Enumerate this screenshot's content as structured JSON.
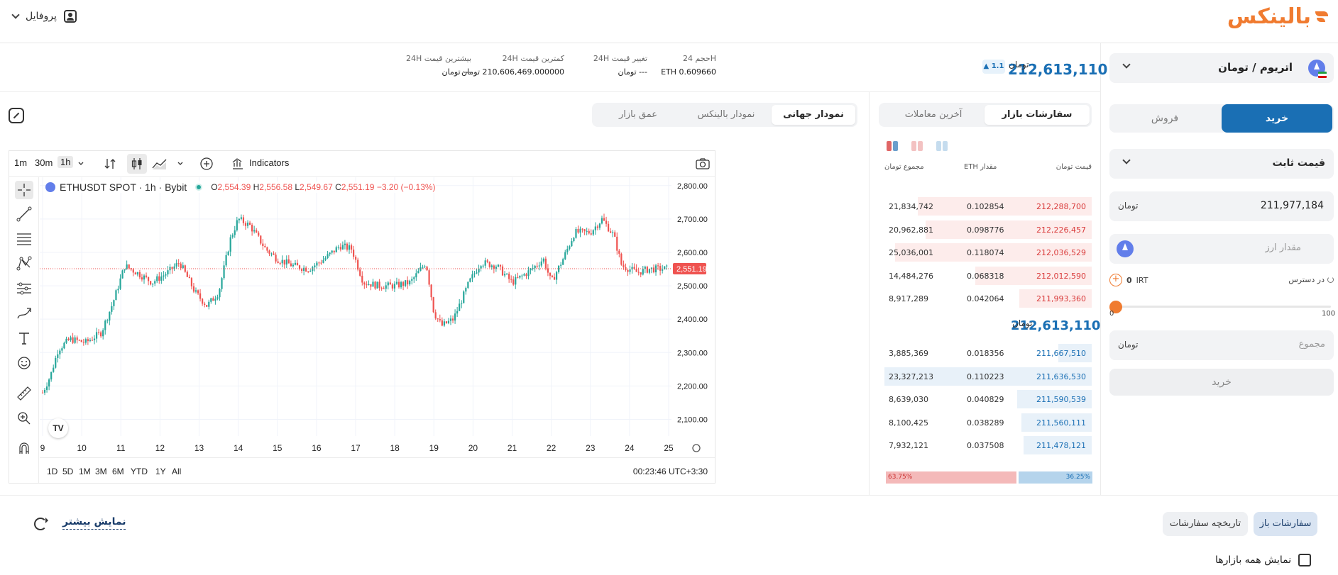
{
  "header": {
    "logo_text": "بالینکس",
    "profile_label": "پروفایل"
  },
  "order_form": {
    "pair_label": "اتریوم / تومان",
    "buy_tab": "خرید",
    "sell_tab": "فروش",
    "order_type": "قیمت ثابت",
    "price_value": "211,977,184",
    "price_unit": "تومان",
    "amount_placeholder": "مقدار ارز",
    "available_label": "در دسترس",
    "available_value": "0",
    "available_currency": "IRT",
    "slider_min": "0",
    "slider_max": "100",
    "slider_value": 0,
    "total_placeholder": "مجموع",
    "total_unit": "تومان",
    "submit_label": "خرید"
  },
  "ticker": {
    "last_price": "212,613,110",
    "last_price_unit": "تومان",
    "change": "1.1",
    "stats": [
      {
        "label": "حجم 24H",
        "value": "ETH 0.609660"
      },
      {
        "label": "تغییر قیمت 24H",
        "value": "--- تومان"
      },
      {
        "label": "کمترین قیمت 24H",
        "value": "210,606,469.000000 تومان"
      },
      {
        "label": "بیشترین قیمت 24H",
        "value": "--- تومان"
      }
    ]
  },
  "orderbook": {
    "tabs": [
      "سفارشات بازار",
      "آخرین معاملات"
    ],
    "headers": {
      "price": "قیمت تومان",
      "amount": "مقدار ETH",
      "total": "مجموع تومان"
    },
    "asks": [
      {
        "price": "212,288,700",
        "amount": "0.102854",
        "total": "21,834,742",
        "depth": 0.84
      },
      {
        "price": "212,226,457",
        "amount": "0.098776",
        "total": "20,962,881",
        "depth": 0.8
      },
      {
        "price": "212,036,529",
        "amount": "0.118074",
        "total": "25,036,001",
        "depth": 0.95
      },
      {
        "price": "212,012,590",
        "amount": "0.068318",
        "total": "14,484,276",
        "depth": 0.56
      },
      {
        "price": "211,993,360",
        "amount": "0.042064",
        "total": "8,917,289",
        "depth": 0.35
      }
    ],
    "mid_price": "212,613,110",
    "mid_unit": "تومان",
    "bids": [
      {
        "price": "211,667,510",
        "amount": "0.018356",
        "total": "3,885,369",
        "depth": 0.16
      },
      {
        "price": "211,636,530",
        "amount": "0.110223",
        "total": "23,327,213",
        "depth": 1.0
      },
      {
        "price": "211,590,539",
        "amount": "0.040829",
        "total": "8,639,030",
        "depth": 0.36
      },
      {
        "price": "211,560,111",
        "amount": "0.038289",
        "total": "8,100,425",
        "depth": 0.34
      },
      {
        "price": "211,478,121",
        "amount": "0.037508",
        "total": "7,932,121",
        "depth": 0.33
      }
    ],
    "sell_ratio": "63.75%",
    "buy_ratio": "36.25%",
    "sell_ratio_value": 0.6375
  },
  "chart_panel": {
    "tabs": [
      "نمودار جهانی",
      "نمودار بالینکس",
      "عمق بازار"
    ],
    "timeframes": [
      "1m",
      "30m",
      "1h"
    ],
    "indicators_label": "Indicators",
    "ranges": [
      "1D",
      "5D",
      "1M",
      "3M",
      "6M",
      "YTD",
      "1Y",
      "All"
    ],
    "clock": "00:23:46 UTC+3:30",
    "symbol": "ETHUSDT SPOT · 1h · Bybit",
    "ohlc": {
      "o_label": "O",
      "o": "2,554.39",
      "h_label": "H",
      "h": "2,556.58",
      "l_label": "L",
      "l": "2,549.67",
      "c_label": "C",
      "c": "2,551.19",
      "chg": "−3.20 (−0.13%)"
    },
    "last_label": "2,551.19",
    "colors": {
      "up": "#26a69a",
      "down": "#ef5350"
    }
  },
  "chart_data": {
    "type": "candlestick",
    "title": "",
    "x_ticks": [
      "9",
      "10",
      "11",
      "12",
      "13",
      "14",
      "15",
      "16",
      "17",
      "18",
      "19",
      "20",
      "21",
      "22",
      "23",
      "24",
      "25"
    ],
    "y_ticks": [
      "2,800.00",
      "2,700.00",
      "2,600.00",
      "2,500.00",
      "2,400.00",
      "2,300.00",
      "2,200.00",
      "2,100.00"
    ],
    "ylim": [
      2050,
      2825
    ],
    "last_price": 2551.19,
    "anchors": [
      [
        9.0,
        2180
      ],
      [
        9.2,
        2230
      ],
      [
        9.4,
        2310
      ],
      [
        9.7,
        2340
      ],
      [
        10.1,
        2330
      ],
      [
        10.5,
        2360
      ],
      [
        10.8,
        2450
      ],
      [
        11.1,
        2560
      ],
      [
        11.4,
        2540
      ],
      [
        11.8,
        2510
      ],
      [
        12.2,
        2540
      ],
      [
        12.5,
        2570
      ],
      [
        12.9,
        2480
      ],
      [
        13.2,
        2440
      ],
      [
        13.5,
        2480
      ],
      [
        13.8,
        2640
      ],
      [
        14.0,
        2700
      ],
      [
        14.3,
        2680
      ],
      [
        14.7,
        2610
      ],
      [
        15.0,
        2580
      ],
      [
        15.4,
        2560
      ],
      [
        15.8,
        2550
      ],
      [
        16.2,
        2580
      ],
      [
        16.6,
        2620
      ],
      [
        16.9,
        2610
      ],
      [
        17.2,
        2510
      ],
      [
        17.6,
        2500
      ],
      [
        18.0,
        2500
      ],
      [
        18.4,
        2510
      ],
      [
        18.8,
        2570
      ],
      [
        19.0,
        2420
      ],
      [
        19.2,
        2380
      ],
      [
        19.5,
        2400
      ],
      [
        19.9,
        2510
      ],
      [
        20.2,
        2570
      ],
      [
        20.6,
        2560
      ],
      [
        21.0,
        2510
      ],
      [
        21.4,
        2540
      ],
      [
        21.8,
        2580
      ],
      [
        22.0,
        2510
      ],
      [
        22.3,
        2580
      ],
      [
        22.6,
        2660
      ],
      [
        23.0,
        2660
      ],
      [
        23.3,
        2700
      ],
      [
        23.6,
        2650
      ],
      [
        23.8,
        2560
      ],
      [
        24.2,
        2540
      ],
      [
        24.5,
        2550
      ],
      [
        25.0,
        2551
      ]
    ]
  },
  "bottom": {
    "open_orders": "سفارشات باز",
    "history": "تاریخچه سفارشات",
    "show_more": "نمایش بیشتر",
    "all_markets": "نمایش همه بازارها"
  }
}
